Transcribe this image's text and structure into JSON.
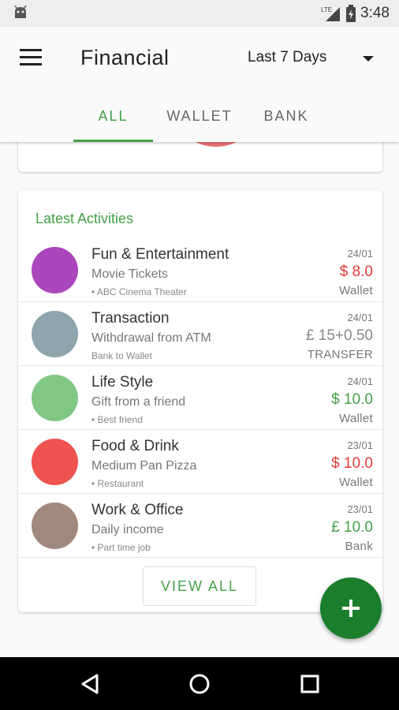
{
  "status_bar": {
    "time": "3:48",
    "icons": [
      "android-icon",
      "lte-signal-icon",
      "battery-charging-icon"
    ]
  },
  "app_bar": {
    "title": "Financial",
    "period": "Last 7 Days",
    "menu_icon": "hamburger-menu-icon",
    "dropdown_icon": "caret-down-icon"
  },
  "tabs": [
    {
      "label": "ALL",
      "selected": true
    },
    {
      "label": "WALLET",
      "selected": false
    },
    {
      "label": "BANK",
      "selected": false
    }
  ],
  "latest_activities": {
    "title": "Latest Activities",
    "items": [
      {
        "category": "Fun & Entertainment",
        "description": "Movie Tickets",
        "note": "• ABC Cinema Theater",
        "date": "24/01",
        "amount": "$ 8.0",
        "source": "Wallet",
        "color": "#ab47bc",
        "amount_color": "#e53935"
      },
      {
        "category": "Transaction",
        "description": "Withdrawal from ATM",
        "note": "Bank to Wallet",
        "date": "24/01",
        "amount": "£ 15+0.50",
        "source": "TRANSFER",
        "color": "#90a4ae",
        "amount_color": "#888888"
      },
      {
        "category": "Life Style",
        "description": "Gift from a friend",
        "note": "• Best friend",
        "date": "24/01",
        "amount": "$ 10.0",
        "source": "Wallet",
        "color": "#81c784",
        "amount_color": "#43a047"
      },
      {
        "category": "Food & Drink",
        "description": "Medium Pan Pizza",
        "note": "• Restaurant",
        "date": "23/01",
        "amount": "$ 10.0",
        "source": "Wallet",
        "color": "#ef5350",
        "amount_color": "#e53935"
      },
      {
        "category": "Work & Office",
        "description": "Daily income",
        "note": "• Part time job",
        "date": "23/01",
        "amount": "£ 10.0",
        "source": "Bank",
        "color": "#a1887f",
        "amount_color": "#43a047"
      }
    ],
    "view_all_label": "VIEW ALL"
  },
  "fab": {
    "icon": "plus-icon"
  },
  "nav_bar": {
    "icons": [
      "back-icon",
      "home-icon",
      "recents-icon"
    ]
  },
  "colors": {
    "accent": "#43a047",
    "fab": "#1b7e2c",
    "expense": "#e53935",
    "income": "#43a047"
  }
}
